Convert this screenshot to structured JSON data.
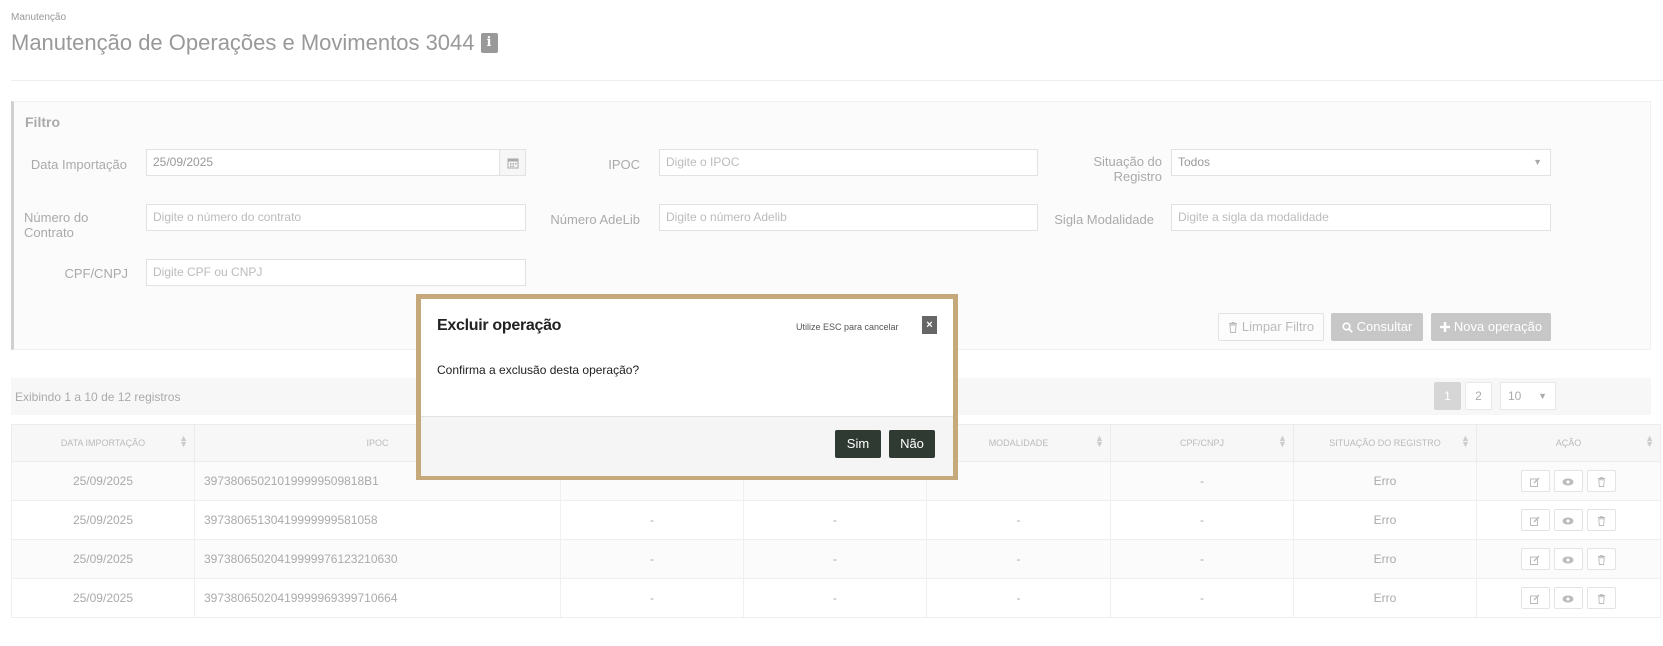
{
  "breadcrumb": "Manutenção",
  "page": {
    "title": "Manutenção de Operações e Movimentos 3044",
    "info_icon": "i"
  },
  "filter": {
    "title": "Filtro",
    "data_importacao": {
      "label": "Data Importação",
      "value": "25/09/2025",
      "icon": "calendar-icon"
    },
    "ipoc": {
      "label": "IPOC",
      "placeholder": "Digite o IPOC"
    },
    "situacao": {
      "label": "Situação do Registro",
      "value": "Todos"
    },
    "numero_contrato": {
      "label": "Número do Contrato",
      "placeholder": "Digite o número do contrato"
    },
    "numero_adelib": {
      "label": "Número AdeLib",
      "placeholder": "Digite o número Adelib"
    },
    "sigla_modalidade": {
      "label": "Sigla Modalidade",
      "placeholder": "Digite a sigla da modalidade"
    },
    "cpf_cnpj": {
      "label": "CPF/CNPJ",
      "placeholder": "Digite CPF ou CNPJ"
    },
    "buttons": {
      "limpar": "Limpar Filtro",
      "consultar": "Consultar",
      "nova": "Nova operação"
    }
  },
  "records": {
    "summary": "Exibindo 1 a 10 de 12 registros",
    "pages": [
      "1",
      "2"
    ],
    "page_size": "10"
  },
  "table": {
    "headers": [
      "Data importação",
      "IPOC",
      "",
      "",
      "Modalidade",
      "CPF/CNPJ",
      "Situação do registro",
      "Ação"
    ],
    "rows": [
      [
        "25/09/2025",
        "397380650210199999509818B1",
        "",
        "",
        "",
        "-",
        "Erro"
      ],
      [
        "25/09/2025",
        "39738065130419999999581058",
        "-",
        "-",
        "-",
        "-",
        "Erro"
      ],
      [
        "25/09/2025",
        "397380650204199999761232106​30",
        "-",
        "-",
        "-",
        "-",
        "Erro"
      ],
      [
        "25/09/2025",
        "39738065020419999969399710664",
        "-",
        "-",
        "-",
        "-",
        "Erro"
      ]
    ]
  },
  "modal": {
    "title": "Excluir operação",
    "hint": "Utilize ESC para cancelar",
    "close": "×",
    "message": "Confirma a exclusão desta operação?",
    "yes": "Sim",
    "no": "Não"
  }
}
